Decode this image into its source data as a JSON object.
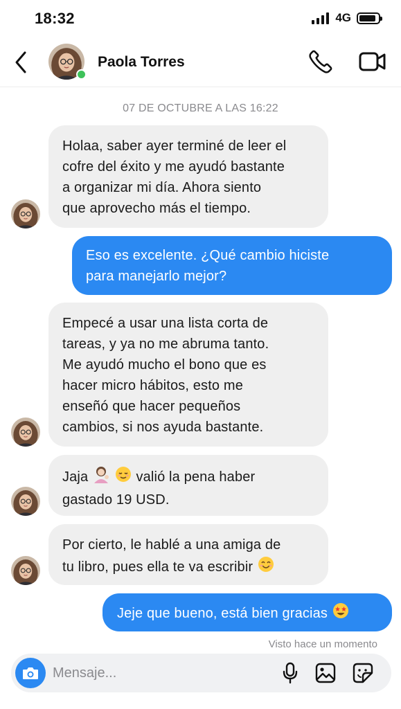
{
  "status_bar": {
    "time": "18:32",
    "network": "4G",
    "signal_icon": "signal-bars-icon",
    "battery_icon": "battery-icon",
    "battery_level": 0.9
  },
  "header": {
    "back_icon": "chevron-left-icon",
    "contact_name": "Paola Torres",
    "online": true,
    "call_icon": "phone-icon",
    "video_icon": "video-camera-icon"
  },
  "conversation": {
    "timestamp": "07 DE OCTUBRE A LAS 16:22",
    "messages": [
      {
        "sender": "contact",
        "lines": [
          "Holaa, saber ayer terminé de leer el",
          "cofre del éxito y me ayudó bastante",
          "a organizar mi día. Ahora siento",
          "que aprovecho más el tiempo."
        ]
      },
      {
        "sender": "me",
        "lines": [
          "Eso es excelente. ¿Qué cambio hiciste",
          "para manejarlo mejor?"
        ]
      },
      {
        "sender": "contact",
        "lines": [
          "Empecé a usar una lista corta de",
          "tareas, y ya no me abruma tanto.",
          "Me ayudó mucho el bono que es",
          "hacer micro hábitos, esto me",
          "enseñó que hacer pequeños",
          "cambios, si nos ayuda bastante."
        ]
      },
      {
        "sender": "contact",
        "line1_start": "Jaja",
        "line1_end": "valió la pena haber",
        "line2": "gastado 19 USD.",
        "emojis": [
          "woman-tipping-hand-emoji",
          "relieved-face-emoji"
        ]
      },
      {
        "sender": "contact",
        "line1": "Por cierto, le hablé a una amiga de",
        "line2": "tu libro, pues ella te va escribir",
        "emojis": [
          "smiling-face-emoji"
        ]
      },
      {
        "sender": "me",
        "text": "Jeje que bueno, está bien gracias",
        "emojis": [
          "star-struck-emoji"
        ]
      }
    ],
    "seen_status": "Visto hace un momento"
  },
  "composer": {
    "placeholder": "Mensaje...",
    "camera_icon": "camera-icon",
    "mic_icon": "microphone-icon",
    "gallery_icon": "gallery-icon",
    "sticker_icon": "sticker-icon"
  },
  "colors": {
    "outgoing_bubble": "#2b89f2",
    "incoming_bubble": "#efefef",
    "online_indicator": "#3ec25a",
    "secondary_text": "#8a8a8e"
  }
}
